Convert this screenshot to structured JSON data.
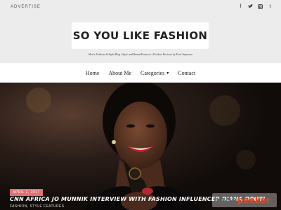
{
  "topbar": {
    "advertise": "ADVERTISE"
  },
  "social": [
    {
      "name": "facebook-icon",
      "glyph": "f"
    },
    {
      "name": "twitter-icon",
      "glyph": "ɸ"
    },
    {
      "name": "instagram-icon",
      "glyph": "▣"
    },
    {
      "name": "tumblr-icon",
      "glyph": "t"
    }
  ],
  "site": {
    "title": "SO YOU LIKE FASHION",
    "tagline": "Men's Fashion & Style Blog | Style and Brand Features | Product Reviews by Fred Amponsa"
  },
  "nav": {
    "home": "Home",
    "about": "About Me",
    "categories": "Categories",
    "contact": "Contact"
  },
  "post": {
    "date": "APRIL 2, 2017",
    "title": "CNN AFRICA JO MUNNIK INTERVIEW WITH FASHION INFLUENCER DIANA OPOTI",
    "categories": "FASHION, STYLE FEATURES"
  },
  "watermark": {
    "text": "pagepeeker"
  },
  "colors": {
    "badge": "#e26f73",
    "hero_bg": "#1a1310"
  }
}
